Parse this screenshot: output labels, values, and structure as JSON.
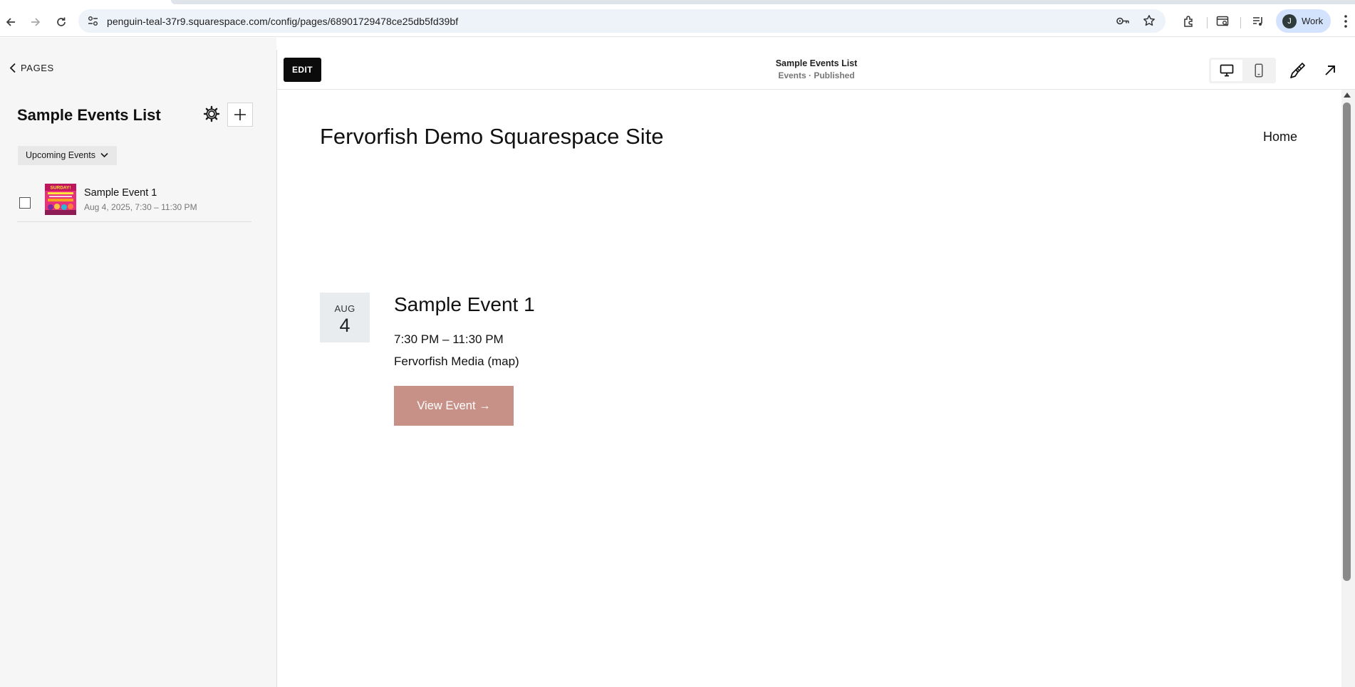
{
  "browser": {
    "url": "penguin-teal-37r9.squarespace.com/config/pages/68901729478ce25db5fd39bf",
    "profile_initial": "J",
    "profile_name": "Work"
  },
  "sidebar": {
    "back_label": "PAGES",
    "page_title": "Sample Events List",
    "filter_label": "Upcoming Events",
    "events": [
      {
        "title": "Sample Event 1",
        "meta": "Aug 4, 2025, 7:30 – 11:30 PM",
        "thumb_text": "SURDAY!"
      }
    ]
  },
  "preview": {
    "edit_label": "EDIT",
    "header_title": "Sample Events List",
    "header_subtitle": "Events · Published",
    "site": {
      "title": "Fervorfish Demo Squarespace Site",
      "nav_home": "Home"
    },
    "event": {
      "month": "AUG",
      "day": "4",
      "title": "Sample Event 1",
      "time": "7:30 PM – 11:30 PM",
      "location": "Fervorfish Media (map)",
      "cta": "View Event →"
    }
  },
  "colors": {
    "accent_button": "#c89188",
    "edit_button": "#0b0b0b",
    "profile_chip": "#d3e3fd",
    "omnibox": "#eef2f9"
  },
  "icons": [
    "back-icon",
    "forward-icon",
    "reload-icon",
    "site-info-icon",
    "password-key-icon",
    "bookmark-star-icon",
    "extensions-icon",
    "tab-search-icon",
    "media-queue-icon",
    "more-menu-icon",
    "chevron-left-icon",
    "gear-icon",
    "plus-icon",
    "chevron-down-icon",
    "desktop-icon",
    "mobile-icon",
    "brush-icon",
    "expand-arrow-icon"
  ]
}
